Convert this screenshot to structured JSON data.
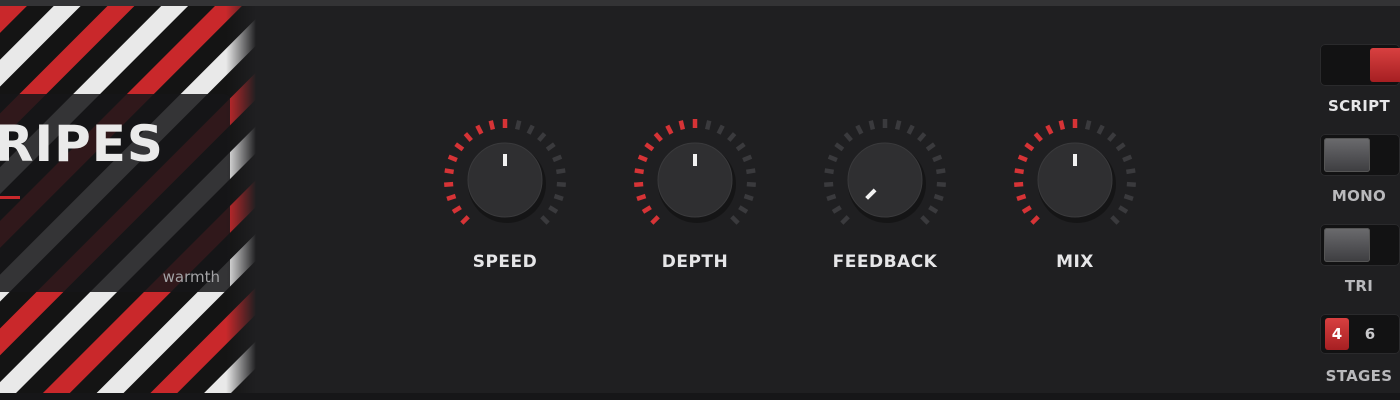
{
  "plugin": {
    "title": "RIPES",
    "subtitle": "warmth"
  },
  "knobs": [
    {
      "label": "SPEED",
      "level": 0.5
    },
    {
      "label": "DEPTH",
      "level": 0.5
    },
    {
      "label": "FEEDBACK",
      "level": 0.0
    },
    {
      "label": "MIX",
      "level": 0.5
    }
  ],
  "switches": [
    {
      "label": "SCRIPT",
      "on": true
    },
    {
      "label": "MONO",
      "on": false
    },
    {
      "label": "TRI",
      "on": false
    }
  ],
  "stages": {
    "label": "STAGES",
    "options": [
      "4",
      "6"
    ],
    "selected": "4"
  },
  "colors": {
    "accent": "#d63336",
    "inactive_tick": "#3a3a3d",
    "label_active": "#e6e6e8",
    "label_inactive": "#b9b9bc"
  }
}
